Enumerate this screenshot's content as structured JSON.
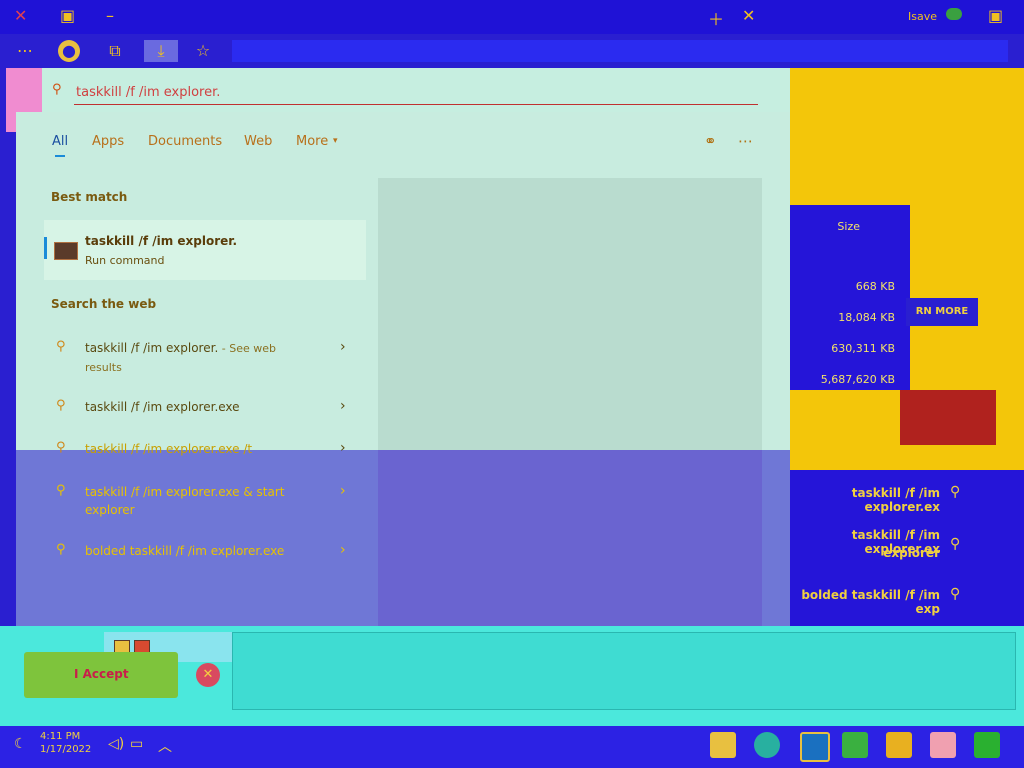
{
  "browser": {
    "profile_label": "Isave",
    "toolbar_icons": [
      "more-icon",
      "avatar",
      "collections-icon",
      "download-icon",
      "favorites-icon"
    ]
  },
  "search": {
    "query": "taskkill /f /im explorer.",
    "tabs": [
      "All",
      "Apps",
      "Documents",
      "Web",
      "More"
    ],
    "active_tab": "All",
    "best_match_title": "Best match",
    "best_match": {
      "title": "taskkill /f /im explorer.",
      "subtitle": "Run command"
    },
    "web_title": "Search the web",
    "web_results": [
      {
        "text": "taskkill /f /im explorer.",
        "suffix": " - See web",
        "line2": "results"
      },
      {
        "text": "taskkill /f /im explorer.exe"
      },
      {
        "text": "taskkill /f /im explorer.exe /t"
      },
      {
        "text": "taskkill /f /im explorer.exe & start",
        "line2": "explorer"
      },
      {
        "text": "bolded taskkill /f /im explorer.exe"
      }
    ]
  },
  "background_page": {
    "size_header": "Size",
    "sizes": [
      "668 KB",
      "18,084 KB",
      "630,311 KB",
      "5,687,620 KB"
    ],
    "learn_more": "RN MORE",
    "right_results": [
      "taskkill /f /im explorer.ex",
      "taskkill /f /im explorer.ex",
      "explorer",
      "bolded taskkill /f /im exp"
    ]
  },
  "dialog": {
    "accept_label": "I Accept"
  },
  "taskbar": {
    "time": "4:11 PM",
    "date": "1/17/2022"
  },
  "colors": {
    "accent": "#1a8bd8",
    "panel": "#c8ecdf"
  }
}
